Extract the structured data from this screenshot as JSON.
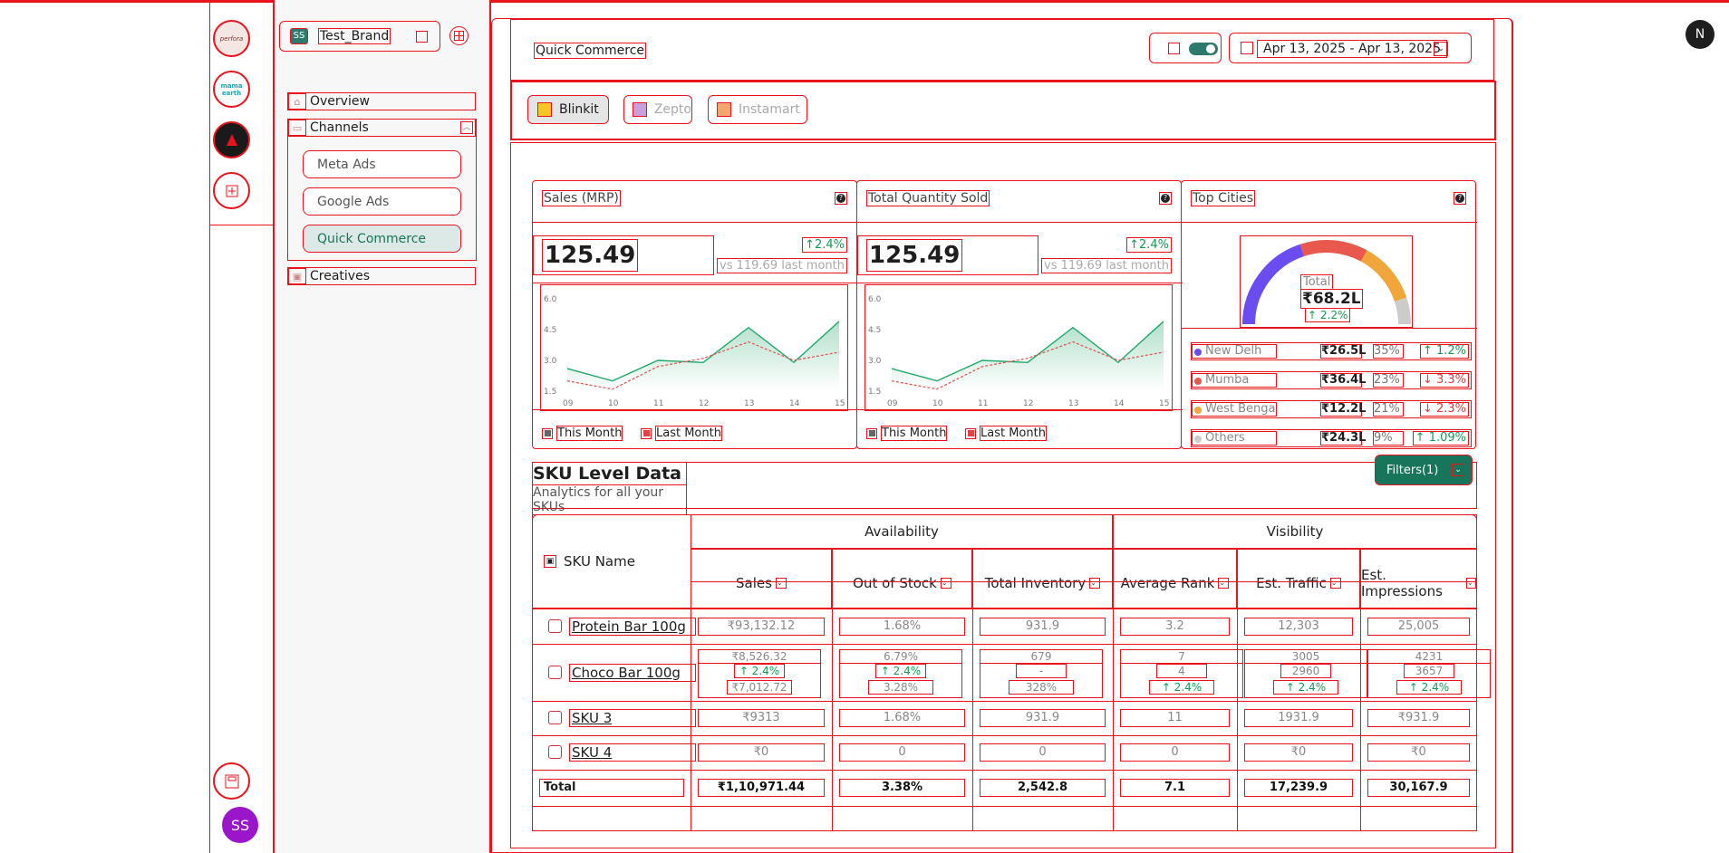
{
  "rail": {
    "brands": [
      {
        "label": "perfora"
      },
      {
        "label": "mama earth"
      }
    ],
    "avatar_initials": "SS",
    "avatar_color": "#9b16c9",
    "n_badge": "N"
  },
  "sidebar": {
    "brand_initials": "SS",
    "brand_name": "Test_Brand",
    "nav": {
      "overview": "Overview",
      "channels": "Channels",
      "creatives": "Creatives"
    },
    "channel_items": [
      "Meta Ads",
      "Google Ads",
      "Quick Commerce"
    ],
    "active_item": "Quick Commerce"
  },
  "header": {
    "title": "Quick Commerce",
    "date_range": "Apr 13, 2025 - Apr 13, 2025",
    "toggle_on": true
  },
  "platform_tabs": [
    "Blinkit",
    "Zepto",
    "Instamart"
  ],
  "active_platform": "Blinkit",
  "colors": {
    "accent": "#17755b",
    "up": "#159a54",
    "down": "#e03a3a",
    "debug_border": "#e8131d"
  },
  "cards": {
    "sales": {
      "title": "Sales (MRP)",
      "value": "125.49",
      "change": "2.4%",
      "vs": "vs 119.69 last month",
      "legend_this": "This Month",
      "legend_last": "Last Month"
    },
    "qty": {
      "title": "Total Quantity Sold",
      "value": "125.49",
      "change": "2.4%",
      "vs": "vs 119.69 last month",
      "legend_this": "This Month",
      "legend_last": "Last Month"
    },
    "cities": {
      "title": "Top Cities",
      "total_label": "Total",
      "total_value": "₹68.2L",
      "total_change": "2.2%",
      "rows": [
        {
          "name": "New Delh",
          "value": "₹26.5L",
          "share": "35%",
          "change": "1.2%",
          "dir": "up",
          "color": "#6a4cf0"
        },
        {
          "name": "Mumba",
          "value": "₹36.4L",
          "share": "23%",
          "change": "3.3%",
          "dir": "down",
          "color": "#e8584d"
        },
        {
          "name": "West Benga",
          "value": "₹12.2L",
          "share": "21%",
          "change": "2.3%",
          "dir": "down",
          "color": "#f0a63a"
        },
        {
          "name": "Others",
          "value": "₹24.3L",
          "share": "9%",
          "change": "1.09%",
          "dir": "up",
          "color": "#cccccc"
        }
      ]
    }
  },
  "chart_data": [
    {
      "type": "area",
      "x": [
        "09",
        "10",
        "11",
        "12",
        "13",
        "14",
        "15"
      ],
      "yticks": [
        "1.5",
        "3.0",
        "4.5",
        "6.0"
      ],
      "ylim": [
        1.5,
        6.0
      ],
      "series": [
        {
          "name": "This Month",
          "values": [
            2.6,
            2.0,
            3.0,
            2.9,
            4.6,
            2.9,
            4.9
          ]
        },
        {
          "name": "Last Month",
          "values": [
            2.0,
            1.6,
            2.7,
            3.1,
            3.9,
            3.0,
            3.4
          ]
        }
      ]
    },
    {
      "type": "area",
      "x": [
        "09",
        "10",
        "11",
        "12",
        "13",
        "14",
        "15"
      ],
      "yticks": [
        "1.5",
        "3.0",
        "4.5",
        "6.0"
      ],
      "ylim": [
        1.5,
        6.0
      ],
      "series": [
        {
          "name": "This Month",
          "values": [
            2.6,
            2.0,
            3.0,
            2.9,
            4.6,
            2.9,
            4.9
          ]
        },
        {
          "name": "Last Month",
          "values": [
            2.0,
            1.6,
            2.7,
            3.1,
            3.9,
            3.0,
            3.4
          ]
        }
      ]
    },
    {
      "type": "pie",
      "categories": [
        "New Delh",
        "Mumba",
        "West Benga",
        "Others"
      ],
      "values": [
        35,
        23,
        21,
        9
      ]
    }
  ],
  "sku": {
    "title": "SKU Level Data",
    "subtitle": "Analytics for all your SKUs",
    "filters_label": "Filters(1)",
    "group_availability": "Availability",
    "group_visibility": "Visibility",
    "col_name": "SKU Name",
    "columns": [
      "Sales",
      "Out of Stock",
      "Total Inventory",
      "Average Rank",
      "Est. Traffic",
      "Est. Impressions"
    ],
    "rows": [
      {
        "name": "Protein Bar 100g",
        "cells": [
          "₹93,132.12",
          "1.68%",
          "931.9",
          "3.2",
          "12,303",
          "25,005"
        ]
      },
      {
        "name": "Choco Bar 100g",
        "cells": [
          "₹8,526.32",
          "6.79%",
          "679",
          "7",
          "3005",
          "4231"
        ],
        "changes": [
          "2.4%",
          "2.4%",
          "-",
          "4",
          "2960",
          "3657"
        ],
        "prev": [
          "₹7,012.72",
          "3.28%",
          "328%",
          "2.4%",
          "2.4%",
          "2.4%"
        ]
      },
      {
        "name": "SKU 3",
        "cells": [
          "₹9313",
          "1.68%",
          "931.9",
          "11",
          "1931.9",
          "₹931.9"
        ]
      },
      {
        "name": "SKU 4",
        "cells": [
          "₹0",
          "0",
          "0",
          "0",
          "₹0",
          "₹0"
        ]
      }
    ],
    "total_label": "Total",
    "totals": [
      "₹1,10,971.44",
      "3.38%",
      "2,542.8",
      "7.1",
      "17,239.9",
      "30,167.9"
    ]
  }
}
